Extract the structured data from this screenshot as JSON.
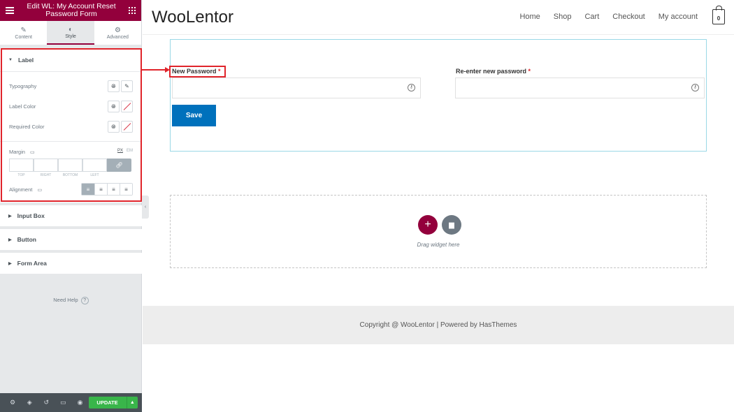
{
  "panel": {
    "title": "Edit WL: My Account Reset Password Form",
    "tabs": [
      {
        "label": "Content",
        "icon": "pencil-icon"
      },
      {
        "label": "Style",
        "icon": "half-circle-icon"
      },
      {
        "label": "Advanced",
        "icon": "gear-icon"
      }
    ],
    "label_section": {
      "title": "Label",
      "controls": [
        {
          "label": "Typography"
        },
        {
          "label": "Label Color"
        },
        {
          "label": "Required Color"
        }
      ],
      "margin": {
        "label": "Margin",
        "units": [
          "PX",
          "EM"
        ],
        "sides": [
          "TOP",
          "RIGHT",
          "BOTTOM",
          "LEFT"
        ]
      },
      "alignment": {
        "label": "Alignment"
      }
    },
    "sections": [
      "Input Box",
      "Button",
      "Form Area"
    ],
    "need_help": "Need Help",
    "update_label": "UPDATE",
    "colors": {
      "brand": "#93003c",
      "update": "#39b54a",
      "highlight": "#e0242b"
    }
  },
  "site": {
    "logo": "WooLentor",
    "nav": [
      "Home",
      "Shop",
      "Cart",
      "Checkout",
      "My account"
    ],
    "cart_count": "0",
    "form": {
      "new_password_label": "New Password",
      "reenter_label": "Re-enter new password",
      "required_mark": "*",
      "save_label": "Save"
    },
    "drop_zone_text": "Drag widget here",
    "footer": "Copyright @ WooLentor | Powered by HasThemes",
    "colors": {
      "save": "#0071bc"
    }
  }
}
